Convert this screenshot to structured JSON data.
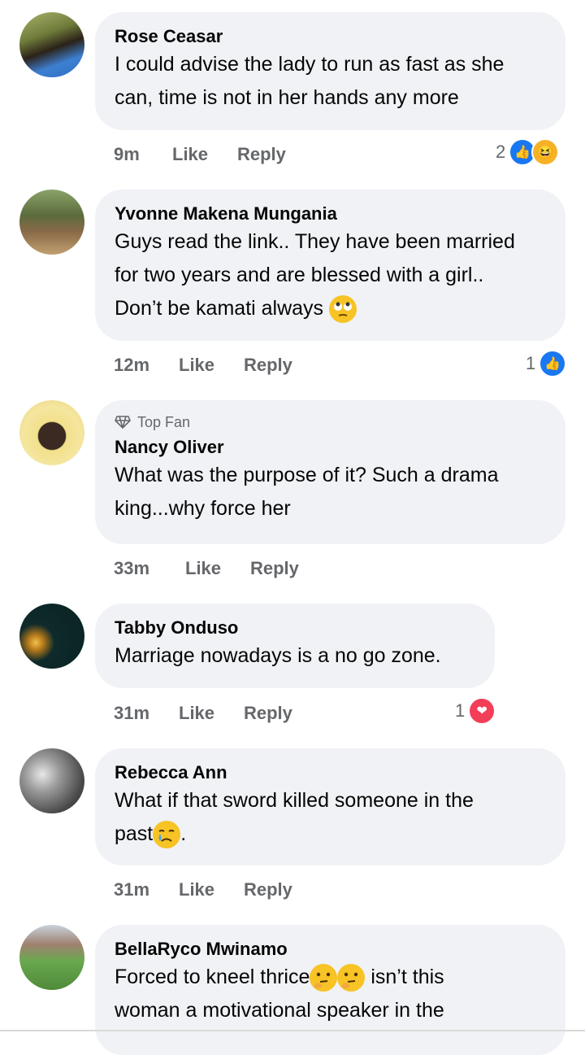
{
  "comments": [
    {
      "name": "Rose Ceasar",
      "lines": [
        "I could advise the lady to run as fast as she",
        "can, time is not in her hands any more"
      ],
      "time": "9m",
      "like": "Like",
      "reply": "Reply",
      "reaction_count": "2",
      "reactions": [
        "like-icon",
        "haha-icon"
      ]
    },
    {
      "name": "Yvonne Makena Mungania",
      "lines": [
        "Guys read the link.. They have been married",
        "for two years and are blessed with a girl..",
        "Don’t be kamati always"
      ],
      "time": "12m",
      "like": "Like",
      "reply": "Reply",
      "reaction_count": "1",
      "reactions": [
        "like-icon"
      ],
      "emoji": "eye-roll-emoji"
    },
    {
      "badge": "Top Fan",
      "name": "Nancy Oliver",
      "lines": [
        "What was the purpose of it? Such a drama",
        "king...why force her"
      ],
      "time": "33m",
      "like": "Like",
      "reply": "Reply"
    },
    {
      "name": "Tabby Onduso",
      "lines": [
        "Marriage nowadays is a no go zone."
      ],
      "time": "31m",
      "like": "Like",
      "reply": "Reply",
      "reaction_count": "1",
      "reactions": [
        "love-icon"
      ]
    },
    {
      "name": "Rebecca Ann",
      "lines": [
        "What if that sword killed someone in the",
        "past",
        "."
      ],
      "time": "31m",
      "like": "Like",
      "reply": "Reply",
      "emoji": "crying-emoji"
    },
    {
      "name": "BellaRyco Mwinamo",
      "lines": [
        "Forced to kneel thrice",
        " isn’t this",
        "woman a motivational speaker in the"
      ],
      "emoji": "thinking-emoji"
    }
  ],
  "colors": {
    "bubble": "#f0f2f5",
    "meta": "#65676b",
    "like_blue": "#1877f2",
    "love_red": "#f33e58",
    "haha_yellow": "#f7b125"
  }
}
